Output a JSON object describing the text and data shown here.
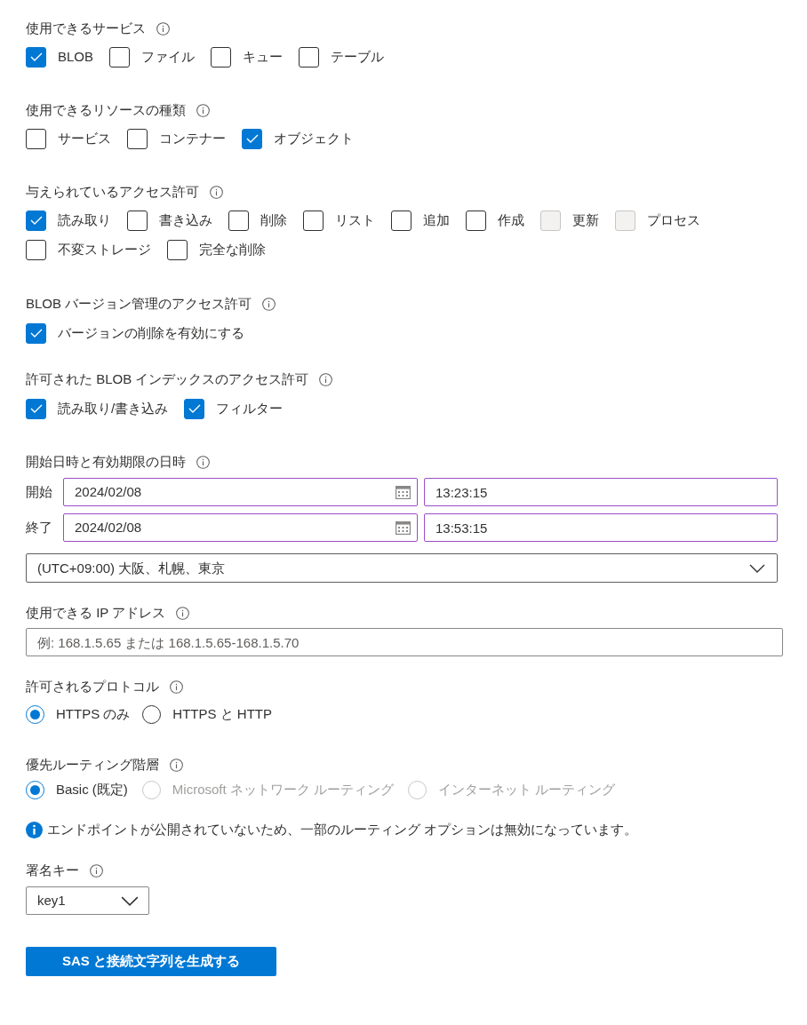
{
  "services": {
    "label": "使用できるサービス",
    "options": [
      {
        "label": "BLOB",
        "checked": true
      },
      {
        "label": "ファイル",
        "checked": false
      },
      {
        "label": "キュー",
        "checked": false
      },
      {
        "label": "テーブル",
        "checked": false
      }
    ]
  },
  "resource_types": {
    "label": "使用できるリソースの種類",
    "options": [
      {
        "label": "サービス",
        "checked": false
      },
      {
        "label": "コンテナー",
        "checked": false
      },
      {
        "label": "オブジェクト",
        "checked": true
      }
    ]
  },
  "permissions": {
    "label": "与えられているアクセス許可",
    "options": [
      {
        "label": "読み取り",
        "checked": true,
        "disabled": false
      },
      {
        "label": "書き込み",
        "checked": false,
        "disabled": false
      },
      {
        "label": "削除",
        "checked": false,
        "disabled": false
      },
      {
        "label": "リスト",
        "checked": false,
        "disabled": false
      },
      {
        "label": "追加",
        "checked": false,
        "disabled": false
      },
      {
        "label": "作成",
        "checked": false,
        "disabled": false
      },
      {
        "label": "更新",
        "checked": false,
        "disabled": true
      },
      {
        "label": "プロセス",
        "checked": false,
        "disabled": true
      },
      {
        "label": "不変ストレージ",
        "checked": false,
        "disabled": false
      },
      {
        "label": "完全な削除",
        "checked": false,
        "disabled": false
      }
    ]
  },
  "blob_versioning": {
    "label": "BLOB バージョン管理のアクセス許可",
    "options": [
      {
        "label": "バージョンの削除を有効にする",
        "checked": true
      }
    ]
  },
  "blob_index": {
    "label": "許可された BLOB インデックスのアクセス許可",
    "options": [
      {
        "label": "読み取り/書き込み",
        "checked": true
      },
      {
        "label": "フィルター",
        "checked": true
      }
    ]
  },
  "validity": {
    "label": "開始日時と有効期限の日時",
    "rows": [
      {
        "label": "開始",
        "date": "2024/02/08",
        "time": "13:23:15"
      },
      {
        "label": "終了",
        "date": "2024/02/08",
        "time": "13:53:15"
      }
    ],
    "timezone": "(UTC+09:00) 大阪、札幌、東京"
  },
  "allowed_ip": {
    "label": "使用できる IP アドレス",
    "placeholder": "例: 168.1.5.65 または 168.1.5.65-168.1.5.70"
  },
  "protocols": {
    "label": "許可されるプロトコル",
    "options": [
      {
        "label": "HTTPS のみ",
        "selected": true
      },
      {
        "label": "HTTPS と HTTP",
        "selected": false
      }
    ]
  },
  "routing_tier": {
    "label": "優先ルーティング階層",
    "options": [
      {
        "label": "Basic (既定)",
        "selected": true,
        "disabled": false
      },
      {
        "label": "Microsoft ネットワーク ルーティング",
        "selected": false,
        "disabled": true
      },
      {
        "label": "インターネット ルーティング",
        "selected": false,
        "disabled": true
      }
    ],
    "notice": "エンドポイントが公開されていないため、一部のルーティング オプションは無効になっています。"
  },
  "signing_key": {
    "label": "署名キー",
    "value": "key1"
  },
  "generate_button": {
    "label": "SAS と接続文字列を生成する"
  }
}
